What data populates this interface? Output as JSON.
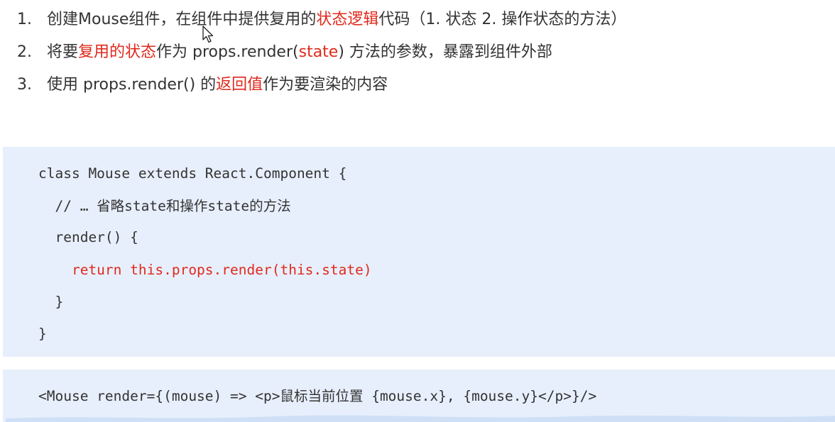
{
  "steps": [
    {
      "num": "1.",
      "parts": [
        {
          "t": "创建Mouse组件，在组件中提供复用的",
          "hl": false
        },
        {
          "t": "状态逻辑",
          "hl": true
        },
        {
          "t": "代码（1. 状态  2. 操作状态的方法）",
          "hl": false
        }
      ]
    },
    {
      "num": "2.",
      "parts": [
        {
          "t": "将要",
          "hl": false
        },
        {
          "t": "复用的状态",
          "hl": true
        },
        {
          "t": "作为 props.render(",
          "hl": false
        },
        {
          "t": "state",
          "hl": true
        },
        {
          "t": ") 方法的参数，暴露到组件外部",
          "hl": false
        }
      ]
    },
    {
      "num": "3.",
      "parts": [
        {
          "t": "使用 props.render() 的",
          "hl": false
        },
        {
          "t": "返回值",
          "hl": true
        },
        {
          "t": "作为要渲染的内容",
          "hl": false
        }
      ]
    }
  ],
  "code_main": [
    {
      "text": "class Mouse extends React.Component {",
      "red": false
    },
    {
      "text": "  // … 省略state和操作state的方法",
      "red": false
    },
    {
      "text": "  render() {",
      "red": false
    },
    {
      "text": "    return this.props.render(this.state)",
      "red": true
    },
    {
      "text": "  }",
      "red": false
    },
    {
      "text": "}",
      "red": false
    }
  ],
  "code_usage": "<Mouse render={(mouse) => <p>鼠标当前位置 {mouse.x}, {mouse.y}</p>}/>",
  "colors": {
    "highlight": "#e02a1c",
    "code_bg": "#e7effc",
    "text": "#333333"
  },
  "icons": {
    "cursor": "mouse-pointer-icon"
  }
}
